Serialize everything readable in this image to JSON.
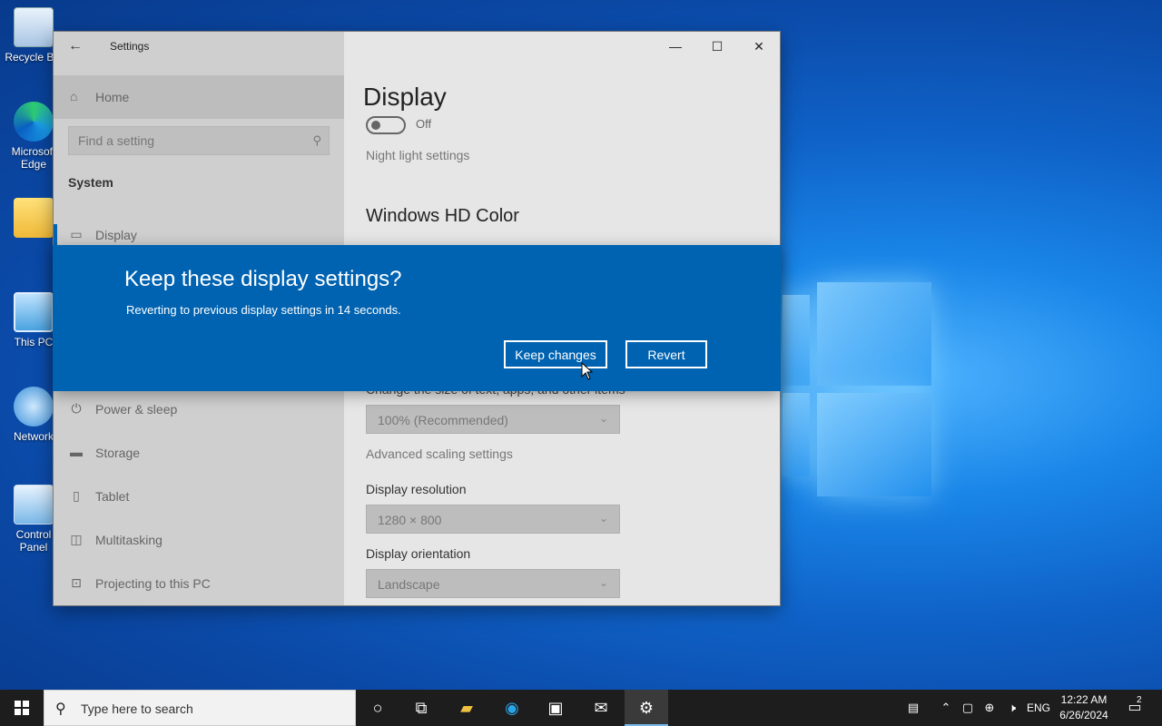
{
  "desktop": {
    "icons": [
      {
        "label": "Recycle Bin",
        "icon": "recycle-bin-icon"
      },
      {
        "label": "Microsoft Edge",
        "icon": "edge-icon"
      },
      {
        "label": "",
        "icon": "user-folder-icon"
      },
      {
        "label": "This PC",
        "icon": "computer-icon"
      },
      {
        "label": "Network",
        "icon": "network-icon"
      },
      {
        "label": "Control Panel",
        "icon": "control-panel-icon"
      }
    ]
  },
  "settings": {
    "title": "Settings",
    "sidebar": {
      "home_label": "Home",
      "search_placeholder": "Find a setting",
      "section_title": "System",
      "items": [
        {
          "label": "Display",
          "icon": "monitor-icon"
        },
        {
          "label": "Power & sleep",
          "icon": "power-icon"
        },
        {
          "label": "Storage",
          "icon": "storage-icon"
        },
        {
          "label": "Tablet",
          "icon": "tablet-icon"
        },
        {
          "label": "Multitasking",
          "icon": "multitasking-icon"
        },
        {
          "label": "Projecting to this PC",
          "icon": "projecting-icon"
        }
      ]
    },
    "main": {
      "page_title": "Display",
      "night_light_state": "Off",
      "night_light_link": "Night light settings",
      "hd_color_heading": "Windows HD Color",
      "scale_label": "Change the size of text, apps, and other items",
      "scale_value": "100% (Recommended)",
      "advanced_scaling_link": "Advanced scaling settings",
      "resolution_label": "Display resolution",
      "resolution_value": "1280 × 800",
      "orientation_label": "Display orientation",
      "orientation_value": "Landscape"
    }
  },
  "dialog": {
    "title": "Keep these display settings?",
    "message": "Reverting to previous display settings in 14 seconds.",
    "keep_label": "Keep changes",
    "revert_label": "Revert"
  },
  "taskbar": {
    "search_placeholder": "Type here to search",
    "language": "ENG",
    "time": "12:22 AM",
    "date": "6/26/2024",
    "notification_count": "2"
  },
  "colors": {
    "accent": "#0063b1",
    "taskbar": "#1d1d1d"
  }
}
